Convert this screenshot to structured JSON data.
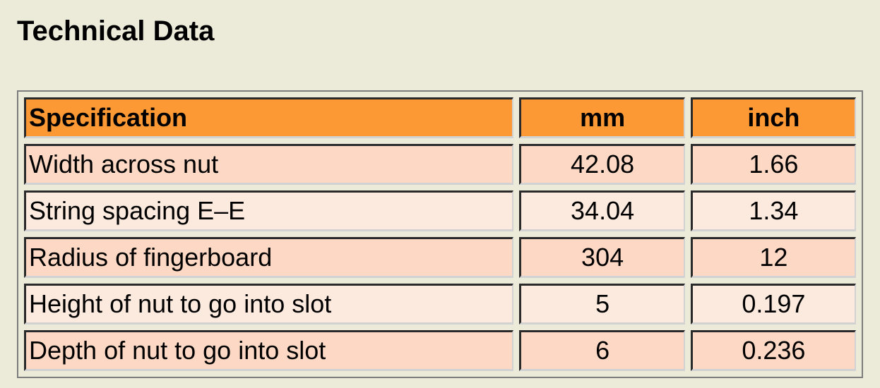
{
  "title": "Technical Data",
  "colors": {
    "page_bg": "#ecead9",
    "header_bg": "#fd9934",
    "row_odd_bg": "#fdd9c5",
    "row_even_bg": "#fdeadf"
  },
  "table": {
    "headers": [
      "Specification",
      "mm",
      "inch"
    ],
    "rows": [
      {
        "spec": "Width across nut",
        "mm": "42.08",
        "inch": "1.66"
      },
      {
        "spec": "String spacing E–E",
        "mm": "34.04",
        "inch": "1.34"
      },
      {
        "spec": "Radius of fingerboard",
        "mm": "304",
        "inch": "12"
      },
      {
        "spec": "Height of nut to go into slot",
        "mm": "5",
        "inch": "0.197"
      },
      {
        "spec": "Depth of nut to go into slot",
        "mm": "6",
        "inch": "0.236"
      }
    ]
  }
}
